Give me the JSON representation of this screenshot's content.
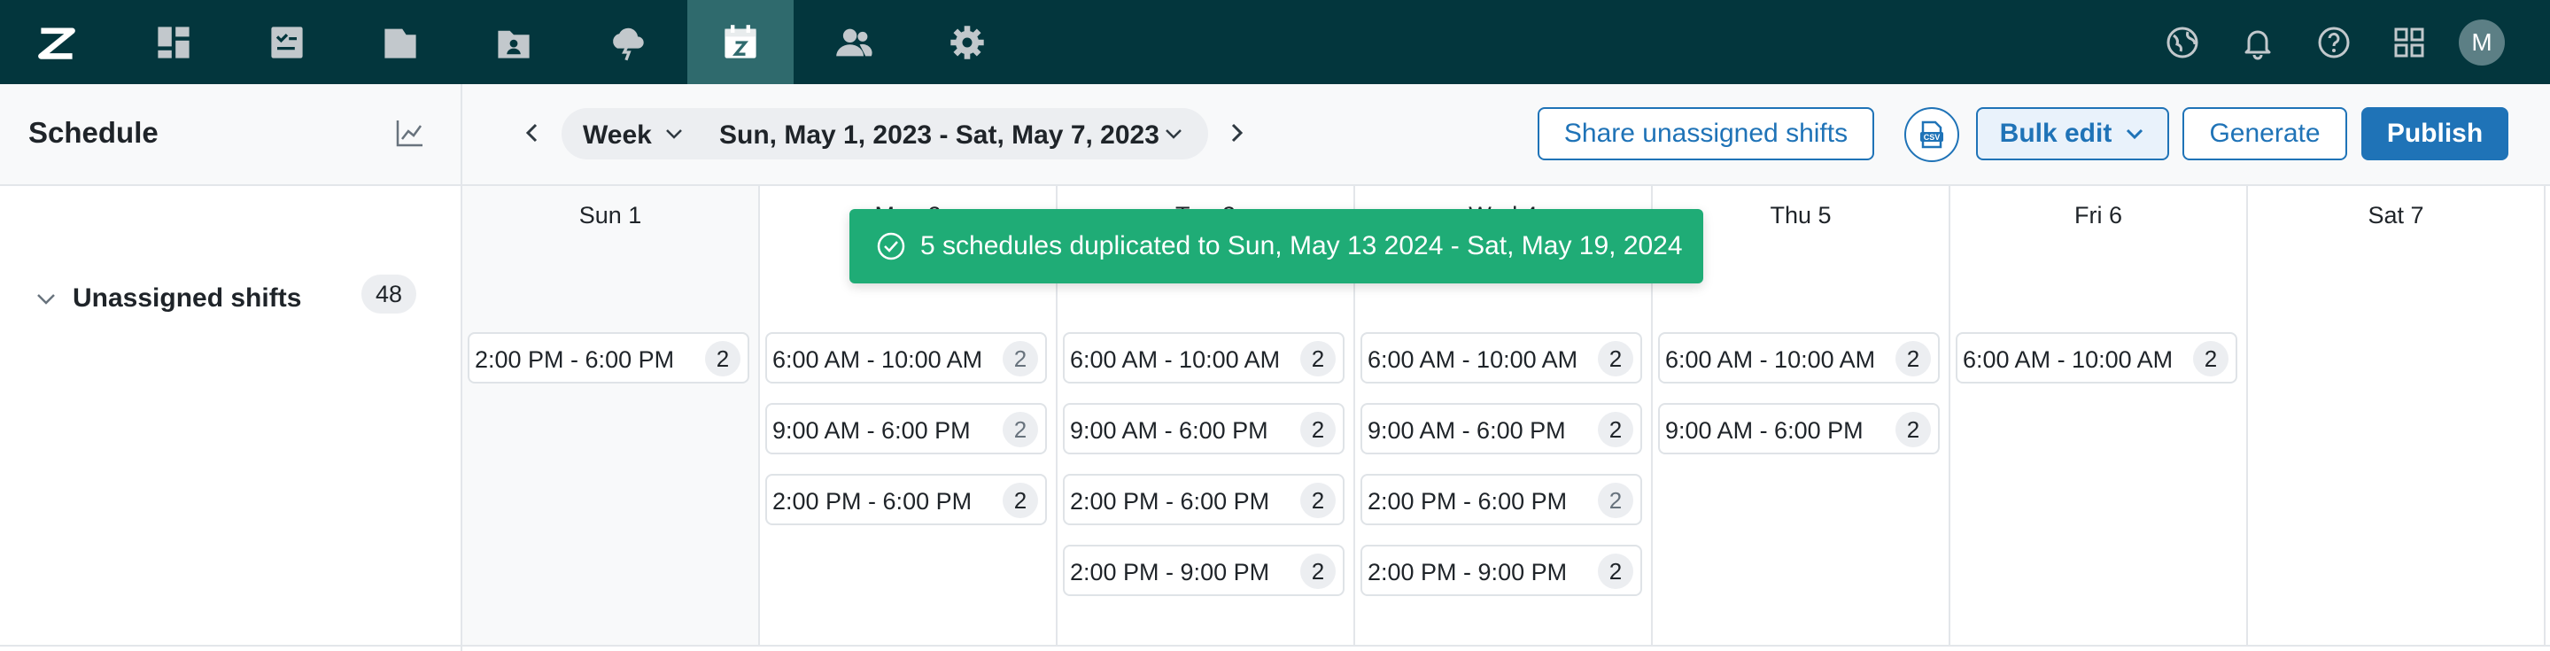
{
  "nav": {
    "items": [
      {
        "name": "zendesk-logo-icon",
        "active": false
      },
      {
        "name": "dashboard-icon",
        "active": false
      },
      {
        "name": "reports-icon",
        "active": false
      },
      {
        "name": "folder-icon",
        "active": false
      },
      {
        "name": "contact-card-icon",
        "active": false
      },
      {
        "name": "forecast-cloud-icon",
        "active": false
      },
      {
        "name": "calendar-icon",
        "active": true
      },
      {
        "name": "people-icon",
        "active": false
      },
      {
        "name": "settings-gear-icon",
        "active": false
      }
    ],
    "utilities": [
      "globe-icon",
      "bell-icon",
      "help-icon",
      "apps-grid-icon"
    ],
    "avatar_initial": "M",
    "colors": {
      "nav_bg": "#03363d",
      "active_bg": "#2f6a6d"
    }
  },
  "header": {
    "title": "Schedule",
    "view": "Week",
    "date_range": "Sun, May 1, 2023 - Sat, May 7, 2023",
    "share_button": "Share unassigned shifts",
    "csv_icon": "csv-export-icon",
    "bulk_edit_button": "Bulk edit",
    "generate_button": "Generate",
    "publish_button": "Publish",
    "accent_color": "#1f73b7"
  },
  "toast": {
    "message": "5 schedules duplicated to Sun, May 13 2024 - Sat, May 19, 2024",
    "color": "#1fac76"
  },
  "sidebar": {
    "group_label": "Unassigned shifts",
    "group_count": "48"
  },
  "days": [
    {
      "label": "Sun 1",
      "shifts": [
        {
          "time": "2:00 PM - 6:00 PM",
          "count": "2",
          "muted": false
        }
      ]
    },
    {
      "label": "Mon 2",
      "shifts": [
        {
          "time": "6:00 AM - 10:00 AM",
          "count": "2",
          "muted": true
        },
        {
          "time": "9:00 AM - 6:00 PM",
          "count": "2",
          "muted": true
        },
        {
          "time": "2:00 PM - 6:00 PM",
          "count": "2",
          "muted": false
        }
      ]
    },
    {
      "label": "Tue 3",
      "shifts": [
        {
          "time": "6:00 AM - 10:00 AM",
          "count": "2",
          "muted": false
        },
        {
          "time": "9:00 AM - 6:00 PM",
          "count": "2",
          "muted": false
        },
        {
          "time": "2:00 PM - 6:00 PM",
          "count": "2",
          "muted": false
        },
        {
          "time": "2:00 PM - 9:00 PM",
          "count": "2",
          "muted": false
        }
      ]
    },
    {
      "label": "Wed 4",
      "shifts": [
        {
          "time": "6:00 AM - 10:00 AM",
          "count": "2",
          "muted": false
        },
        {
          "time": "9:00 AM - 6:00 PM",
          "count": "2",
          "muted": false
        },
        {
          "time": "2:00 PM - 6:00 PM",
          "count": "2",
          "muted": true
        },
        {
          "time": "2:00 PM - 9:00 PM",
          "count": "2",
          "muted": false
        }
      ]
    },
    {
      "label": "Thu 5",
      "shifts": [
        {
          "time": "6:00 AM - 10:00 AM",
          "count": "2",
          "muted": false
        },
        {
          "time": "9:00 AM - 6:00 PM",
          "count": "2",
          "muted": false
        }
      ]
    },
    {
      "label": "Fri 6",
      "shifts": [
        {
          "time": "6:00 AM - 10:00 AM",
          "count": "2",
          "muted": false
        }
      ]
    },
    {
      "label": "Sat 7",
      "shifts": []
    }
  ]
}
